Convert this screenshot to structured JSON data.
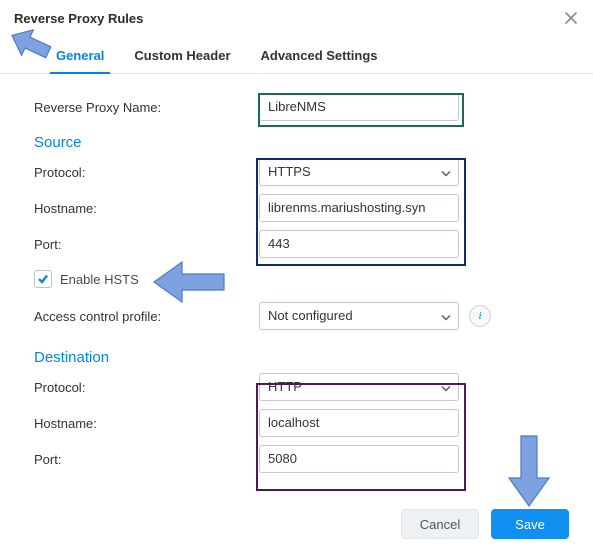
{
  "dialog": {
    "title": "Reverse Proxy Rules"
  },
  "tabs": {
    "general": "General",
    "custom_header": "Custom Header",
    "advanced": "Advanced Settings",
    "active": "general"
  },
  "labels": {
    "reverse_proxy_name": "Reverse Proxy Name:",
    "protocol": "Protocol:",
    "hostname": "Hostname:",
    "port": "Port:",
    "enable_hsts": "Enable HSTS",
    "access_control_profile": "Access control profile:"
  },
  "sections": {
    "source": "Source",
    "destination": "Destination"
  },
  "fields": {
    "reverse_proxy_name": "LibreNMS",
    "source": {
      "protocol": "HTTPS",
      "hostname": "librenms.mariushosting.syn",
      "port": "443",
      "enable_hsts": true
    },
    "access_control_profile": "Not configured",
    "destination": {
      "protocol": "HTTP",
      "hostname": "localhost",
      "port": "5080"
    }
  },
  "buttons": {
    "cancel": "Cancel",
    "save": "Save"
  },
  "icons": {
    "info": "i"
  }
}
